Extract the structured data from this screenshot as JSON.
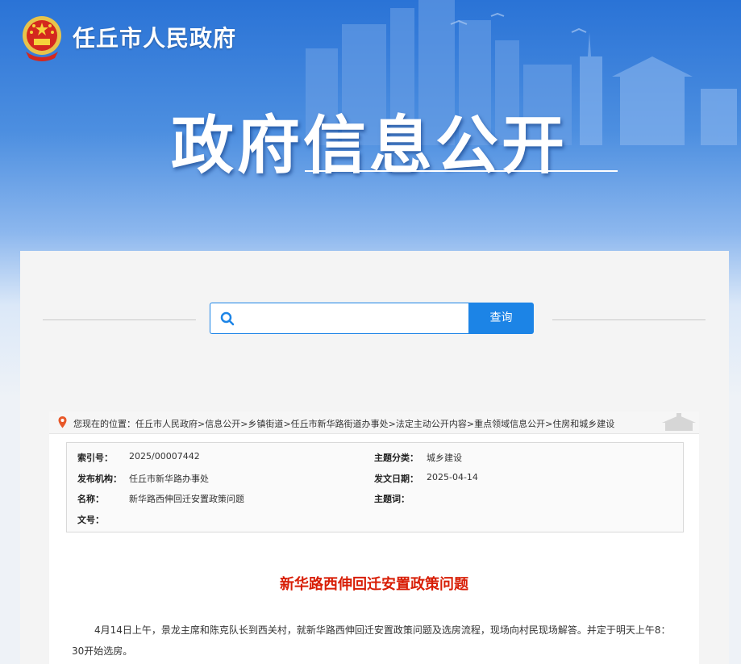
{
  "header": {
    "site_name": "任丘市人民政府",
    "big_title": "政府信息公开"
  },
  "search": {
    "placeholder": "",
    "value": "",
    "button_label": "查询"
  },
  "breadcrumb": {
    "prefix": "您现在的位置：",
    "items": [
      "任丘市人民政府",
      "信息公开",
      "乡镇街道",
      "任丘市新华路街道办事处",
      "法定主动公开内容",
      "重点领域信息公开",
      "住房和城乡建设"
    ],
    "separator": ">"
  },
  "meta": {
    "index_label": "索引号：",
    "index_value": "2025/00007442",
    "topic_label": "主题分类：",
    "topic_value": "城乡建设",
    "org_label": "发布机构：",
    "org_value": "任丘市新华路办事处",
    "date_label": "发文日期：",
    "date_value": "2025-04-14",
    "name_label": "名称：",
    "name_value": "新华路西伸回迁安置政策问题",
    "keyword_label": "主题词：",
    "keyword_value": "",
    "docno_label": "文号：",
    "docno_value": ""
  },
  "article": {
    "title": "新华路西伸回迁安置政策问题",
    "paragraph": "4月14日上午，景龙主席和陈克队长到西关村，就新华路西伸回迁安置政策问题及选房流程，现场向村民现场解答。并定于明天上午8：30开始选房。"
  },
  "colors": {
    "accent": "#1c84e6",
    "title_red": "#d81e06",
    "banner_top": "#2a73d6"
  }
}
